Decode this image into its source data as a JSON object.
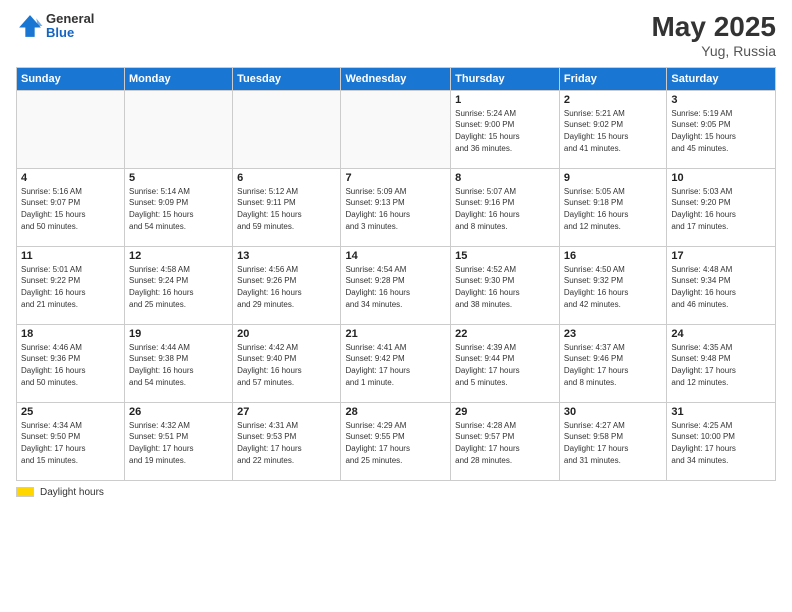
{
  "header": {
    "title": "May 2025",
    "location": "Yug, Russia",
    "logo_general": "General",
    "logo_blue": "Blue"
  },
  "days_of_week": [
    "Sunday",
    "Monday",
    "Tuesday",
    "Wednesday",
    "Thursday",
    "Friday",
    "Saturday"
  ],
  "footer": {
    "label": "Daylight hours"
  },
  "weeks": [
    [
      {
        "day": "",
        "info": ""
      },
      {
        "day": "",
        "info": ""
      },
      {
        "day": "",
        "info": ""
      },
      {
        "day": "",
        "info": ""
      },
      {
        "day": "1",
        "info": "Sunrise: 5:24 AM\nSunset: 9:00 PM\nDaylight: 15 hours\nand 36 minutes."
      },
      {
        "day": "2",
        "info": "Sunrise: 5:21 AM\nSunset: 9:02 PM\nDaylight: 15 hours\nand 41 minutes."
      },
      {
        "day": "3",
        "info": "Sunrise: 5:19 AM\nSunset: 9:05 PM\nDaylight: 15 hours\nand 45 minutes."
      }
    ],
    [
      {
        "day": "4",
        "info": "Sunrise: 5:16 AM\nSunset: 9:07 PM\nDaylight: 15 hours\nand 50 minutes."
      },
      {
        "day": "5",
        "info": "Sunrise: 5:14 AM\nSunset: 9:09 PM\nDaylight: 15 hours\nand 54 minutes."
      },
      {
        "day": "6",
        "info": "Sunrise: 5:12 AM\nSunset: 9:11 PM\nDaylight: 15 hours\nand 59 minutes."
      },
      {
        "day": "7",
        "info": "Sunrise: 5:09 AM\nSunset: 9:13 PM\nDaylight: 16 hours\nand 3 minutes."
      },
      {
        "day": "8",
        "info": "Sunrise: 5:07 AM\nSunset: 9:16 PM\nDaylight: 16 hours\nand 8 minutes."
      },
      {
        "day": "9",
        "info": "Sunrise: 5:05 AM\nSunset: 9:18 PM\nDaylight: 16 hours\nand 12 minutes."
      },
      {
        "day": "10",
        "info": "Sunrise: 5:03 AM\nSunset: 9:20 PM\nDaylight: 16 hours\nand 17 minutes."
      }
    ],
    [
      {
        "day": "11",
        "info": "Sunrise: 5:01 AM\nSunset: 9:22 PM\nDaylight: 16 hours\nand 21 minutes."
      },
      {
        "day": "12",
        "info": "Sunrise: 4:58 AM\nSunset: 9:24 PM\nDaylight: 16 hours\nand 25 minutes."
      },
      {
        "day": "13",
        "info": "Sunrise: 4:56 AM\nSunset: 9:26 PM\nDaylight: 16 hours\nand 29 minutes."
      },
      {
        "day": "14",
        "info": "Sunrise: 4:54 AM\nSunset: 9:28 PM\nDaylight: 16 hours\nand 34 minutes."
      },
      {
        "day": "15",
        "info": "Sunrise: 4:52 AM\nSunset: 9:30 PM\nDaylight: 16 hours\nand 38 minutes."
      },
      {
        "day": "16",
        "info": "Sunrise: 4:50 AM\nSunset: 9:32 PM\nDaylight: 16 hours\nand 42 minutes."
      },
      {
        "day": "17",
        "info": "Sunrise: 4:48 AM\nSunset: 9:34 PM\nDaylight: 16 hours\nand 46 minutes."
      }
    ],
    [
      {
        "day": "18",
        "info": "Sunrise: 4:46 AM\nSunset: 9:36 PM\nDaylight: 16 hours\nand 50 minutes."
      },
      {
        "day": "19",
        "info": "Sunrise: 4:44 AM\nSunset: 9:38 PM\nDaylight: 16 hours\nand 54 minutes."
      },
      {
        "day": "20",
        "info": "Sunrise: 4:42 AM\nSunset: 9:40 PM\nDaylight: 16 hours\nand 57 minutes."
      },
      {
        "day": "21",
        "info": "Sunrise: 4:41 AM\nSunset: 9:42 PM\nDaylight: 17 hours\nand 1 minute."
      },
      {
        "day": "22",
        "info": "Sunrise: 4:39 AM\nSunset: 9:44 PM\nDaylight: 17 hours\nand 5 minutes."
      },
      {
        "day": "23",
        "info": "Sunrise: 4:37 AM\nSunset: 9:46 PM\nDaylight: 17 hours\nand 8 minutes."
      },
      {
        "day": "24",
        "info": "Sunrise: 4:35 AM\nSunset: 9:48 PM\nDaylight: 17 hours\nand 12 minutes."
      }
    ],
    [
      {
        "day": "25",
        "info": "Sunrise: 4:34 AM\nSunset: 9:50 PM\nDaylight: 17 hours\nand 15 minutes."
      },
      {
        "day": "26",
        "info": "Sunrise: 4:32 AM\nSunset: 9:51 PM\nDaylight: 17 hours\nand 19 minutes."
      },
      {
        "day": "27",
        "info": "Sunrise: 4:31 AM\nSunset: 9:53 PM\nDaylight: 17 hours\nand 22 minutes."
      },
      {
        "day": "28",
        "info": "Sunrise: 4:29 AM\nSunset: 9:55 PM\nDaylight: 17 hours\nand 25 minutes."
      },
      {
        "day": "29",
        "info": "Sunrise: 4:28 AM\nSunset: 9:57 PM\nDaylight: 17 hours\nand 28 minutes."
      },
      {
        "day": "30",
        "info": "Sunrise: 4:27 AM\nSunset: 9:58 PM\nDaylight: 17 hours\nand 31 minutes."
      },
      {
        "day": "31",
        "info": "Sunrise: 4:25 AM\nSunset: 10:00 PM\nDaylight: 17 hours\nand 34 minutes."
      }
    ]
  ]
}
